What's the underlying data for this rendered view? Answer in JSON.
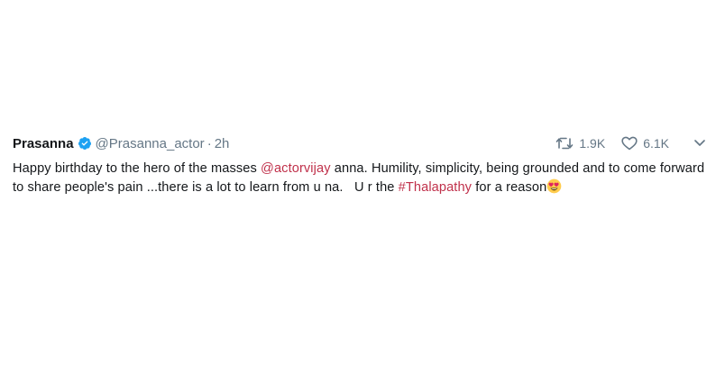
{
  "tweet": {
    "author_name": "Prasanna",
    "handle": "@Prasanna_actor",
    "separator": "·",
    "time": "2h",
    "retweets": "1.9K",
    "likes": "6.1K",
    "text_part1": "Happy birthday to the hero of the masses ",
    "mention": "@actorvijay",
    "text_part2": " anna. Humility, simplicity, being grounded and to come forward to share people's pain ...there is a lot to learn from u na.   U r the ",
    "hashtag": "#Thalapathy",
    "text_part3": " for a reason",
    "emoji": "heart-eyes-emoji"
  },
  "colors": {
    "link": "#c0314b",
    "verified": "#1da1f2",
    "muted": "#657786"
  }
}
